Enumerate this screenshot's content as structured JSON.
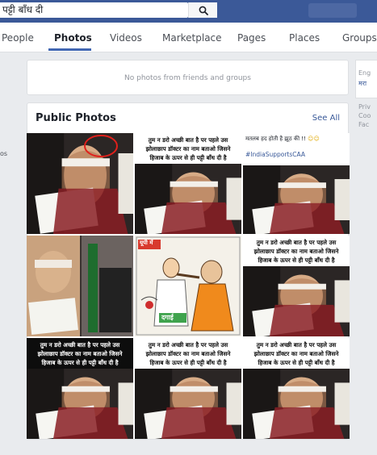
{
  "search": {
    "query": "पट्टी बाँध दी"
  },
  "icons": {
    "search": "magnifier-icon",
    "laugh": "laughing-emoji-icon"
  },
  "colors": {
    "topbar": "#3b5998",
    "link": "#385898",
    "accent": "#4267b2"
  },
  "tabs": [
    {
      "label": "People"
    },
    {
      "label": "Photos",
      "active": true
    },
    {
      "label": "Videos"
    },
    {
      "label": "Marketplace"
    },
    {
      "label": "Pages"
    },
    {
      "label": "Places"
    },
    {
      "label": "Groups"
    }
  ],
  "friends_photos": {
    "message": "No photos from friends and groups"
  },
  "public_photos": {
    "title": "Public Photos",
    "see_all": "See All",
    "photos": [
      {
        "type": "photo",
        "caption_lines": []
      },
      {
        "type": "text_photo",
        "caption_lines": [
          "तुम न डरो अच्छी बात है पर पहले उस",
          "झोलाछाप डॉक्टर का नाम बताओ जिसने",
          "हिजाब के ऊपर से ही पट्टी बाँध दी है"
        ]
      },
      {
        "type": "text_photo_pink",
        "caption_lines": [
          "मतलब हद होती है झूठ की !!"
        ],
        "hashtag": "#IndiaSupportsCAA"
      },
      {
        "type": "collage",
        "caption_lines": []
      },
      {
        "type": "cartoon",
        "caption_lines": [],
        "tag": "यूपी में",
        "label": "दगाई"
      },
      {
        "type": "text_photo",
        "caption_lines": [
          "तुम न डरो अच्छी बात है पर पहले उस",
          "झोलाछाप डॉक्टर का नाम बताओ जिसने",
          "हिजाब के ऊपर से ही पट्टी बाँध दी है"
        ]
      },
      {
        "type": "text_photo_dark",
        "caption_lines": [
          "तुम न डरो अच्छी बात है पर पहले उस",
          "झोलाछाप डॉक्टर का नाम बताओ जिसने",
          "हिजाब के ऊपर से ही पट्टी बाँध दी है"
        ]
      },
      {
        "type": "text_photo",
        "caption_lines": [
          "तुम न डरो अच्छी बात है पर पहले उस",
          "झोलाछाप डॉक्टर का नाम बताओ जिसने",
          "हिजाब के ऊपर से ही पट्टी बाँध दी है"
        ]
      },
      {
        "type": "text_photo",
        "caption_lines": [
          "तुम न डरो अच्छी बात है पर पहले उस",
          "झोलाछाप डॉक्टर का नाम बताओ जिसने",
          "हिजाब के ऊपर से ही पट्टी बाँध दी है"
        ]
      }
    ]
  },
  "right_column": {
    "lines": [
      "Eng",
      "मरा",
      "Priv",
      "Coo",
      "Fac"
    ]
  },
  "left_fragment": "os"
}
